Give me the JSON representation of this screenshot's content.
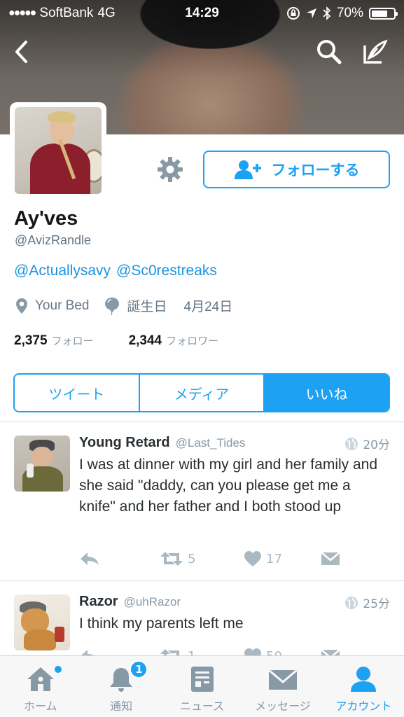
{
  "status_bar": {
    "carrier": "SoftBank",
    "network": "4G",
    "time": "14:29",
    "battery": "70%",
    "battery_level": 0.7
  },
  "profile": {
    "display_name": "Ay'ves",
    "handle": "@AvizRandle",
    "bio_links": [
      "@Actuallysavy",
      "@Sc0restreaks"
    ],
    "location": "Your Bed",
    "birthday_label": "誕生日",
    "birthday_value": "4月24日",
    "following_count": "2,375",
    "following_label": "フォロー",
    "followers_count": "2,344",
    "followers_label": "フォロワー",
    "follow_button_label": "フォローする"
  },
  "segments": {
    "tweets": "ツイート",
    "media": "メディア",
    "likes": "いいね",
    "active": "likes"
  },
  "tweets": [
    {
      "name": "Young Retard",
      "handle": "@Last_Tides",
      "time": "20分",
      "text": "I was at dinner with my girl and her family and she said \"daddy, can you please get me a knife\" and her father and I both stood up",
      "retweets": "5",
      "likes": "17"
    },
    {
      "name": "Razor",
      "handle": "@uhRazor",
      "time": "25分",
      "text": "I think my parents left me",
      "retweets": "1",
      "likes": "50"
    }
  ],
  "tabbar": {
    "home": "ホーム",
    "notifications": "通知",
    "notifications_badge": "1",
    "news": "ニュース",
    "messages": "メッセージ",
    "account": "アカウント",
    "active": "account"
  },
  "colors": {
    "accent": "#1da1f2",
    "text_primary": "#14171a",
    "text_secondary": "#657786",
    "icon_gray": "#aab8c2"
  },
  "icons": {
    "back": "chevron-left-icon",
    "search": "search-icon",
    "compose": "compose-icon",
    "settings": "gear-icon",
    "follow": "add-user-icon",
    "location": "location-pin-icon",
    "birthday": "balloon-icon",
    "globe": "globe-icon",
    "reply": "reply-icon",
    "retweet": "retweet-icon",
    "like": "heart-icon",
    "dm": "envelope-icon"
  }
}
